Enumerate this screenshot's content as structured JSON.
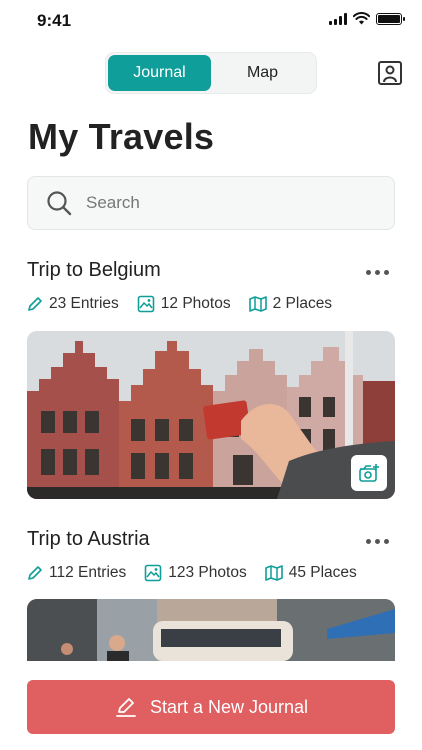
{
  "status_bar": {
    "time": "9:41"
  },
  "header": {
    "tabs": [
      {
        "label": "Journal",
        "active": true
      },
      {
        "label": "Map",
        "active": false
      }
    ],
    "profile_icon": "profile-icon"
  },
  "page": {
    "title": "My Travels"
  },
  "search": {
    "placeholder": "Search",
    "value": ""
  },
  "trips": [
    {
      "title": "Trip to Belgium",
      "stats": {
        "entries": "23 Entries",
        "photos": "12 Photos",
        "places": "2 Places"
      }
    },
    {
      "title": "Trip to Austria",
      "stats": {
        "entries": "112 Entries",
        "photos": "123 Photos",
        "places": "45 Places"
      }
    }
  ],
  "cta": {
    "label": "Start a New Journal"
  },
  "colors": {
    "accent": "#0f9e99",
    "cta": "#e05f60",
    "text": "#222222"
  }
}
